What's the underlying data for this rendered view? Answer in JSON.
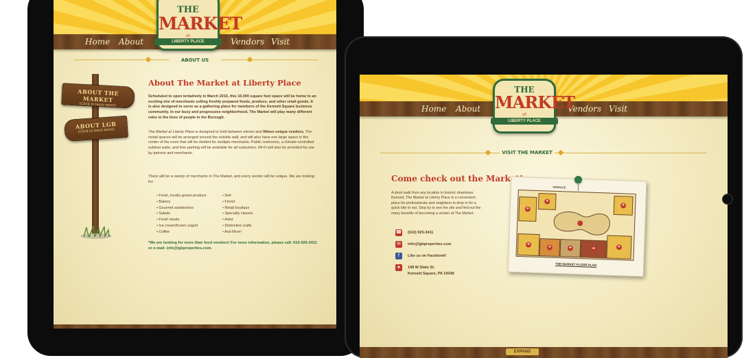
{
  "left_page": {
    "nav": {
      "home": "Home",
      "about": "About",
      "vendors": "Vendors",
      "visit": "Visit"
    },
    "logo": {
      "the": "THE",
      "market": "MARKET",
      "at": "at",
      "ribbon": "LIBERTY PLACE"
    },
    "section_label": "ABOUT US",
    "signpost": {
      "sign1_title": "ABOUT THE MARKET",
      "sign1_sub": "(Click to learn more)",
      "sign2_title": "ABOUT LGB",
      "sign2_sub": "(Click to learn more)"
    },
    "heading": "About The Market at Liberty Place",
    "para1": "Scheduled to open tentatively in March 2015, this 10,000 square foot space will be home to an exciting mix of merchants selling freshly prepared foods, produce, and other retail goods. It is also designed to serve as a gathering place for members of the Kennett Square business community. In our busy and progressive neighborhood, The Market will play many different roles in the lives of people in the Borough.",
    "para2_em": "The Market at Liberty Place",
    "para2_a": " is designed to hold between eleven and ",
    "para2_b": "fifteen unique vendors.",
    "para2_c": " The rental spaces will be arranged around the outside wall, and will also have one large space in the center of the room that will be divided for multiple merchants. Public restrooms, a climate-controlled outdoor patio, and free parking will be available for all customers. Wi-Fi will also be provided for use by patrons and merchants.",
    "para3": "There will be a variety of merchants in The Market, and every vendor will be unique. We are looking for:",
    "list_left": [
      "Fresh, locally-grown produce",
      "Bakery",
      "Gourmet sandwiches",
      "Salads",
      "Fresh meats",
      "Ice cream/frozen yogurt",
      "Coffee"
    ],
    "list_right": [
      "Deli",
      "Florist",
      "Retail boutique",
      "Specialty classes",
      "Artist",
      "Distinctive crafts",
      "And More!"
    ],
    "callout": "*We are looking for more than food vendors! For more information, please call: 610-925-3411 or e-mail: info@lgbproperties.com."
  },
  "right_page": {
    "nav": {
      "home": "Home",
      "about": "About",
      "vendors": "Vendors",
      "visit": "Visit"
    },
    "logo": {
      "the": "THE",
      "market": "MARKET",
      "at": "at",
      "ribbon": "LIBERTY PLACE"
    },
    "section_label": "VISIT THE MARKET",
    "heading": "Come check out the Market!",
    "intro": "A short walk from any location in historic downtown Kennett, The Market at Liberty Place is a convenient place for professionals and neighbors to drop in for a quick bite to eat. Stop by to see the site and find out the many benefits of becoming a vendor at The Market.",
    "contacts": {
      "phone": "(610) 925-3411",
      "email": "info@lgbproperties.com",
      "facebook": "Like us on Facebook!",
      "address_line1": "148 W State St.",
      "address_line2": "Kennett Square, PA 19348"
    },
    "map": {
      "terrace": "TERRACE",
      "caption": "THE MARKET FLOOR PLAN"
    },
    "expand": "EXPAND"
  },
  "colors": {
    "accent_red": "#c0392b",
    "accent_green": "#2f6b3b",
    "wood": "#6b4321",
    "paper": "#f4ecc2",
    "sun": "#f7c62d"
  }
}
